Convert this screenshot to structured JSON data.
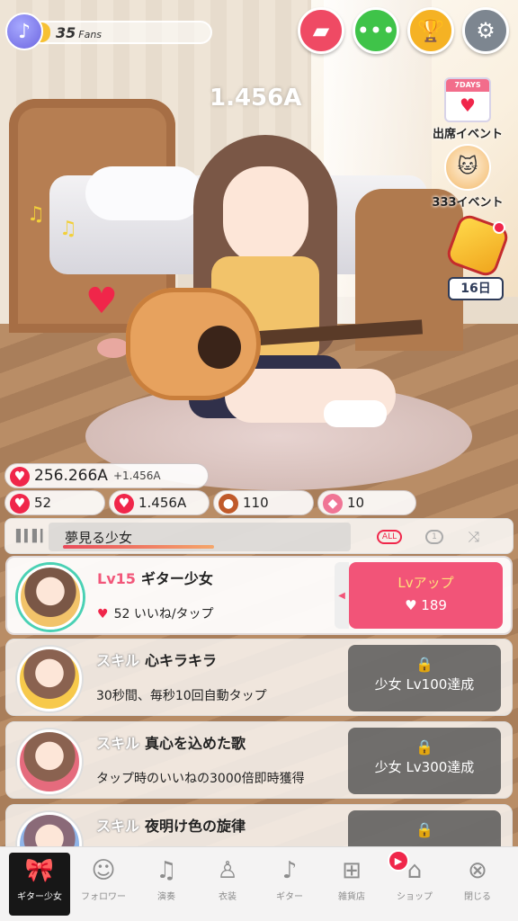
{
  "hud": {
    "fans_count": "35",
    "fans_label": "Fans",
    "fans_progress": 0.1,
    "floating_amount": "1.456A"
  },
  "events": {
    "attendance_label": "出席イベント",
    "attendance_calendar": "7DAYS",
    "event333_label": "333イベント",
    "star_days": "16日"
  },
  "resources": {
    "total_likes": "256.266A",
    "per_second": "+1.456A",
    "likes_per_tap": "52",
    "timed_likes": "1.456A",
    "basketball": "110",
    "candy": "10"
  },
  "player": {
    "song_title": "夢見る少女",
    "progress": 0.5,
    "repeat_all": "ALL",
    "repeat_one": "1"
  },
  "cards": [
    {
      "level": "Lv15",
      "name": "ギター少女",
      "desc": "52 いいね/タップ",
      "button_title": "Lvアップ",
      "button_cost": "189"
    },
    {
      "prefix": "スキル",
      "name": "心キラキラ",
      "desc": "30秒間、毎秒10回自動タップ",
      "lock_text": "少女 Lv100達成"
    },
    {
      "prefix": "スキル",
      "name": "真心を込めた歌",
      "desc": "タップ時のいいねの3000倍即時獲得",
      "lock_text": "少女 Lv300達成"
    },
    {
      "prefix": "スキル",
      "name": "夜明け色の旋律"
    }
  ],
  "nav": [
    {
      "label": "ギター少女",
      "icon": "bow-icon"
    },
    {
      "label": "フォロワー",
      "icon": "followers-icon"
    },
    {
      "label": "演奏",
      "icon": "music-note-icon"
    },
    {
      "label": "衣装",
      "icon": "dress-icon"
    },
    {
      "label": "ギター",
      "icon": "guitar-icon"
    },
    {
      "label": "雑貨店",
      "icon": "gift-icon"
    },
    {
      "label": "ショップ",
      "icon": "shop-icon"
    },
    {
      "label": "閉じる",
      "icon": "close-icon"
    }
  ],
  "colors": {
    "accent_pink": "#f25478",
    "heart_red": "#f0264a",
    "green_button": "#3fc349",
    "gold_button": "#f5b224",
    "gray_button": "#7d8690"
  }
}
